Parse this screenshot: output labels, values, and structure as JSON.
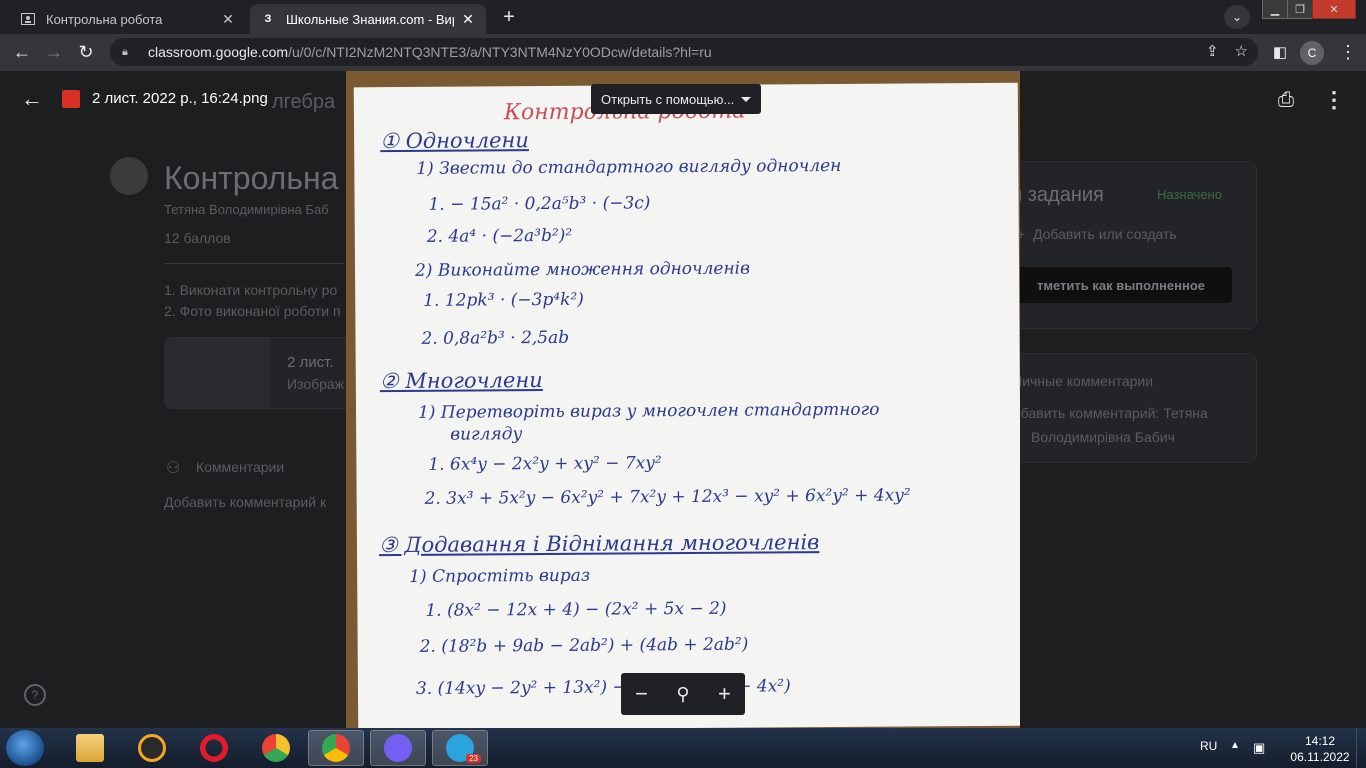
{
  "browser": {
    "tabs": [
      {
        "title": "Контрольна робота",
        "active": false,
        "favicon": "classroom-icon"
      },
      {
        "title": "Школьные Знания.com - Виріш",
        "active": true,
        "favicon": "znanija-icon",
        "favicon_text": "З"
      }
    ],
    "address": {
      "host": "classroom.google.com",
      "path": "/u/0/c/NTI2NzM2NTQ3NTE3/a/NTY3NTM4NzY0ODcw/details?hl=ru"
    },
    "profile_initial": "C"
  },
  "viewer": {
    "file_name": "2 лист. 2022 р., 16:24.png",
    "open_with_label": "Открыть с помощью..."
  },
  "background_page": {
    "title": "Контрольна",
    "course_name": "лгебра",
    "teacher": "Тетяна Володимирівна Баб",
    "points": "12 баллов",
    "instructions": [
      "1. Виконати контрольну ро",
      "2. Фото виконаної роботи п"
    ],
    "attachment_title": "2 лист.",
    "attachment_type": "Изображ",
    "comments_label": "Комментарии",
    "add_comment": "Добавить комментарий к",
    "assignment_title": "и задания",
    "status": "Назначено",
    "add_or_create": "Добавить или создать",
    "mark_done": "тметить как выполненное",
    "private_comments": "Личные комментарии",
    "add_private_comment_1": "обавить комментарий: Тетяна",
    "add_private_comment_2": "Володимирівна Бабич"
  },
  "handwriting": {
    "heading": "Контрольна робота",
    "s1": "① Одночлени",
    "s1_1": "1) Звести до стандартного вигляду одночлен",
    "s1_1a": "1.  − 15a² · 0,2a⁵b³ · (−3c)",
    "s1_1b": "2.   4a⁴ · (−2a³b²)²",
    "s1_2": "2) Виконайте множення одночленів",
    "s1_2a": "1.  12pk³ · (−3p⁴k²)",
    "s1_2b": "2.  0,8a²b³ · 2,5ab",
    "s2": "② Многочлени",
    "s2_1": "1) Перетворіть вираз у многочлен стандартного",
    "s2_1c": "вигляду",
    "s2_1a": "1.   6x⁴y − 2x²y + xy² − 7xy²",
    "s2_1b": "2.  3x³ + 5x²y − 6x²y² + 7x²y + 12x³ − xy² + 6x²y² + 4xy²",
    "s3": "③ Додавання і Віднімання многочленів",
    "s3_1": "1) Спростіть вираз",
    "s3_1a": "1.   (8x² − 12x + 4) − (2x² + 5x − 2)",
    "s3_1b": "2.  (18²b + 9ab − 2ab²) + (4ab + 2ab²)",
    "s3_1c": "3.  (14xy − 2y² + 13x²) − (16x² − 5xy + 4x²)"
  },
  "taskbar": {
    "language": "RU",
    "time": "14:12",
    "date": "06.11.2022",
    "telegram_badge": "23"
  }
}
